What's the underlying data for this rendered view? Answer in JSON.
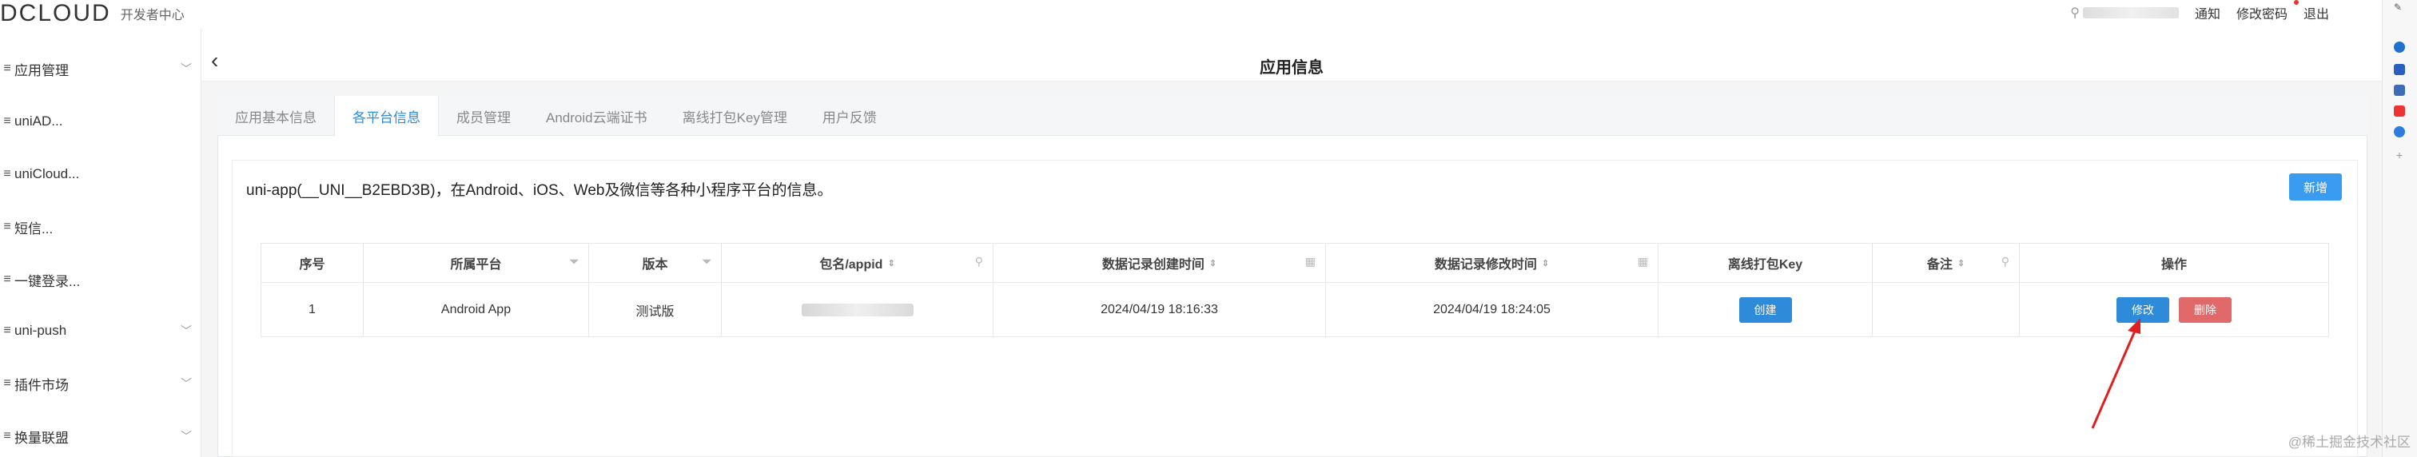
{
  "header": {
    "logo_text": "DCLOUD",
    "logo_sub": "开发者中心",
    "user_icon": "user-search-icon",
    "links": [
      "通知",
      "修改密码",
      "退出"
    ]
  },
  "sidebar": {
    "items": [
      {
        "label": "应用管理",
        "expandable": true
      },
      {
        "label": "uniAD...",
        "expandable": false
      },
      {
        "label": "uniCloud...",
        "expandable": false
      },
      {
        "label": "短信...",
        "expandable": false
      },
      {
        "label": "一键登录...",
        "expandable": false
      },
      {
        "label": "uni-push",
        "expandable": true
      },
      {
        "label": "插件市场",
        "expandable": true
      },
      {
        "label": "换量联盟",
        "expandable": true
      }
    ]
  },
  "page": {
    "title": "应用信息",
    "tabs": [
      "应用基本信息",
      "各平台信息",
      "成员管理",
      "Android云端证书",
      "离线打包Key管理",
      "用户反馈"
    ],
    "active_tab": 1,
    "description": "uni-app(__UNI__B2EBD3B)，在Android、iOS、Web及微信等各种小程序平台的信息。",
    "add_button": "新增"
  },
  "table": {
    "columns": [
      "序号",
      "所属平台",
      "版本",
      "包名/appid",
      "数据记录创建时间",
      "数据记录修改时间",
      "离线打包Key",
      "备注",
      "操作"
    ],
    "rows": [
      {
        "index": "1",
        "platform": "Android App",
        "version": "测试版",
        "appid": "",
        "created": "2024/04/19 18:16:33",
        "modified": "2024/04/19 18:24:05",
        "key_button": "创建",
        "edit_button": "修改",
        "delete_button": "删除"
      }
    ]
  },
  "watermark": "@稀土掘金技术社区",
  "colors": {
    "accent": "#2e8bd9",
    "danger": "#e06a6a",
    "annotation": "#e02020"
  }
}
